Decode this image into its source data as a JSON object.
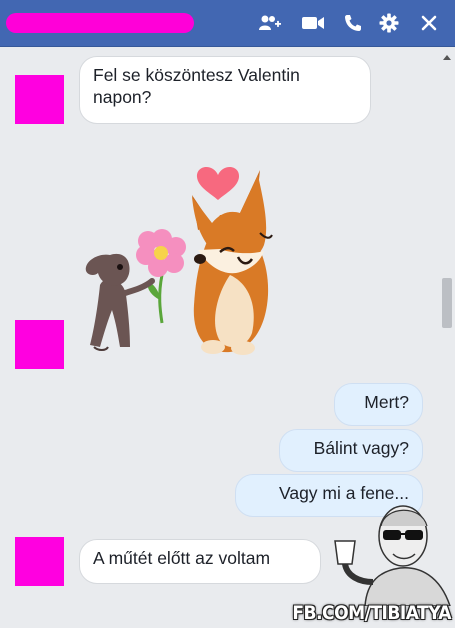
{
  "header": {
    "contact_name": "",
    "colors": {
      "bar": "#4267b2",
      "icon": "#ffffff"
    },
    "icons": [
      "add-people-icon",
      "video-call-icon",
      "phone-call-icon",
      "gear-icon",
      "close-icon"
    ]
  },
  "messages": [
    {
      "side": "incoming",
      "text": "Fel se köszöntesz Valentin napon?"
    },
    {
      "side": "incoming",
      "sticker": "dog-with-flower-and-fox-sticker"
    },
    {
      "side": "outgoing",
      "text": "Mert?"
    },
    {
      "side": "outgoing",
      "text": "Bálint vagy?"
    },
    {
      "side": "outgoing",
      "text": "Vagy mi a fene..."
    },
    {
      "side": "incoming",
      "text": "A műtét előtt az voltam"
    }
  ],
  "watermark": {
    "text": "FB.COM/TIBIATYA"
  },
  "colors": {
    "avatar_placeholder": "#ff00e0",
    "outgoing_bubble": "#e1f0fe",
    "incoming_bubble": "#ffffff"
  }
}
